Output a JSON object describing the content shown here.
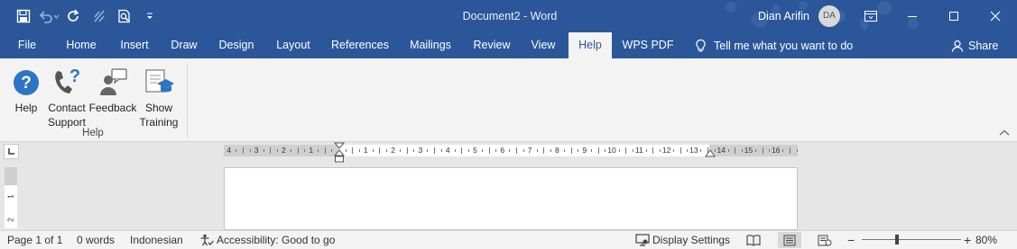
{
  "window": {
    "title": "Document2  -  Word",
    "user_name": "Dian Arifin",
    "avatar_initials": "DA",
    "accent_color": "#2b579a"
  },
  "quick_access": [
    "save-icon",
    "undo-icon",
    "redo-icon",
    "touch-mode-icon",
    "print-preview-icon",
    "customize-qat-icon"
  ],
  "tabs": [
    {
      "label": "File"
    },
    {
      "label": "Home"
    },
    {
      "label": "Insert"
    },
    {
      "label": "Draw"
    },
    {
      "label": "Design"
    },
    {
      "label": "Layout"
    },
    {
      "label": "References"
    },
    {
      "label": "Mailings"
    },
    {
      "label": "Review"
    },
    {
      "label": "View"
    },
    {
      "label": "Help",
      "active": true
    },
    {
      "label": "WPS PDF"
    }
  ],
  "tell_me": "Tell me what you want to do",
  "share": "Share",
  "ribbon": {
    "buttons": [
      {
        "line1": "Help",
        "line2": "",
        "icon": "help-icon"
      },
      {
        "line1": "Contact",
        "line2": "Support",
        "icon": "contact-support-icon"
      },
      {
        "line1": "Feedback",
        "line2": "",
        "icon": "feedback-icon"
      },
      {
        "line1": "Show",
        "line2": "Training",
        "icon": "training-icon"
      }
    ],
    "group_label": "Help"
  },
  "ruler": {
    "labels": [
      "4",
      "3",
      "2",
      "1",
      "1",
      "2",
      "3",
      "4",
      "5",
      "6",
      "7",
      "8",
      "9",
      "10",
      "11",
      "12",
      "13",
      "14",
      "15",
      "16"
    ],
    "vertical_labels": [
      "1",
      "2"
    ]
  },
  "status": {
    "page": "Page 1 of 1",
    "words": "0 words",
    "language": "Indonesian",
    "accessibility": "Accessibility: Good to go",
    "display_settings": "Display Settings",
    "zoom_minus": "−",
    "zoom_plus": "+",
    "zoom": "80%"
  }
}
